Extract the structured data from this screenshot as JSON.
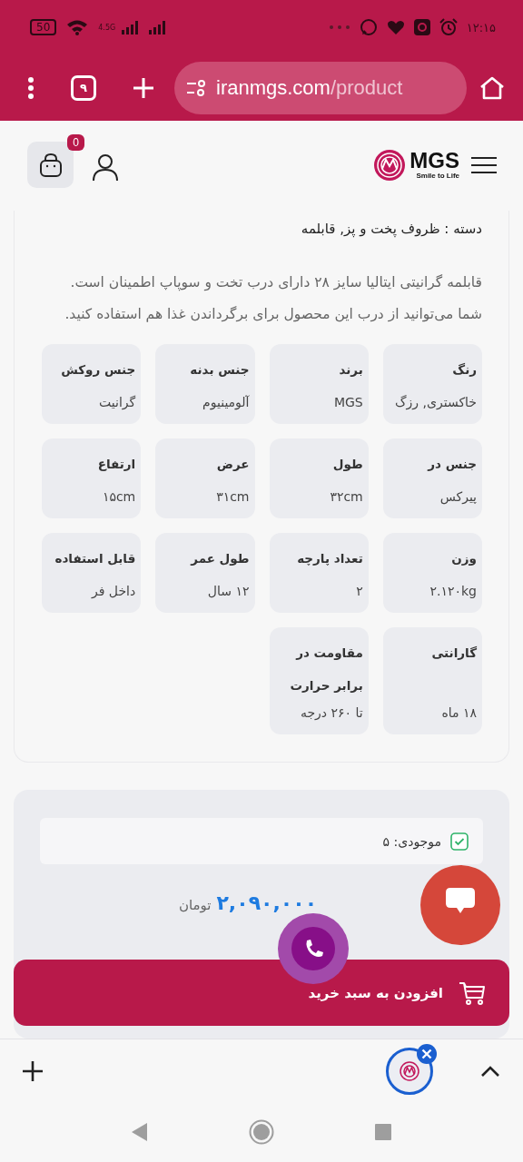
{
  "status_bar": {
    "battery": "50",
    "network": "4.5G",
    "time": "۱۲:۱۵"
  },
  "browser_toolbar": {
    "tab_count": "۹",
    "url_host": "iranmgs.com",
    "url_path": "/product"
  },
  "header": {
    "cart_count": "0",
    "logo_name": "MGS",
    "logo_tagline": "Smile to Life"
  },
  "product": {
    "category": "دسته : ظروف پخت و پز, قابلمه",
    "description": "قابلمه گرانیتی ایتالیا سایز ۲۸ دارای درب تخت و سوپاپ اطمینان است. شما می‌توانید از درب این محصول برای برگرداندن غذا هم استفاده کنید.",
    "specs": [
      {
        "label": "رنگ",
        "value": "خاکستری, رزگ"
      },
      {
        "label": "برند",
        "value": "MGS"
      },
      {
        "label": "جنس بدنه",
        "value": "آلومینیوم"
      },
      {
        "label": "جنس روکش",
        "value": "گرانیت"
      },
      {
        "label": "جنس در",
        "value": "پیرکس"
      },
      {
        "label": "طول",
        "value": "۳۲cm"
      },
      {
        "label": "عرض",
        "value": "۳۱cm"
      },
      {
        "label": "ارتفاع",
        "value": "۱۵cm"
      },
      {
        "label": "وزن",
        "value": "۲.۱۲۰kg"
      },
      {
        "label": "تعداد پارچه",
        "value": "۲"
      },
      {
        "label": "طول عمر",
        "value": "۱۲ سال"
      },
      {
        "label": "قابل استفاده",
        "value": "داخل فر"
      },
      {
        "label": "گارانتی",
        "value": "۱۸ ماه"
      },
      {
        "label": "مقاومت در برابر حرارت",
        "value": "تا ۲۶۰ درجه"
      }
    ]
  },
  "purchase": {
    "stock": "موجودی: ۵",
    "in_stock": true,
    "price": "۲,۰۹۰,۰۰۰",
    "currency": "تومان",
    "add_to_cart": "افزودن به سبد خرید"
  }
}
